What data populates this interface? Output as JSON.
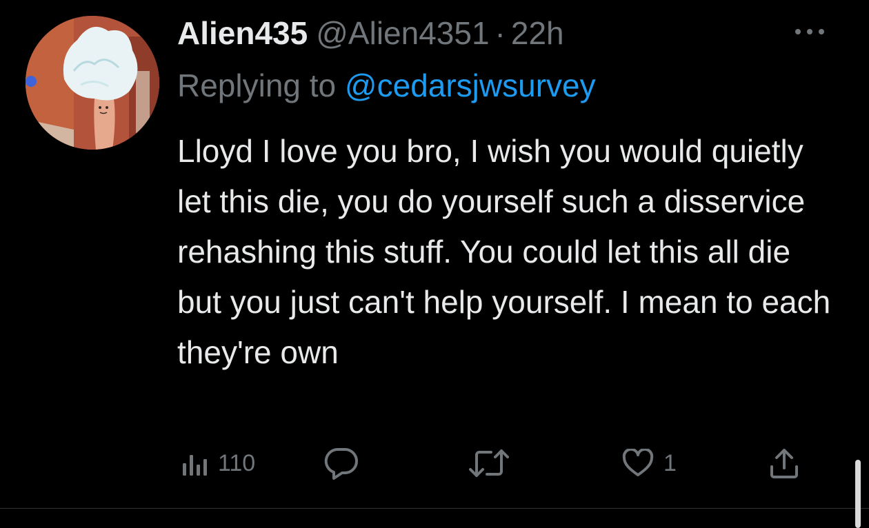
{
  "tweet": {
    "display_name": "Alien435",
    "handle": "@Alien4351",
    "separator": "·",
    "time": "22h",
    "replying_prefix": "Replying to",
    "replying_mention": "@cedarsjwsurvey",
    "text": "Lloyd I love you bro, I wish you would quietly let this die, you do yourself such a disservice rehashing this stuff. You could let this all die but you just can't help yourself. I mean to each they're own"
  },
  "actions": {
    "views": {
      "icon": "analytics-icon",
      "count": "110"
    },
    "reply": {
      "icon": "reply-bubble-icon"
    },
    "retweet": {
      "icon": "retweet-icon"
    },
    "like": {
      "icon": "heart-icon",
      "count": "1"
    },
    "share": {
      "icon": "share-icon"
    }
  },
  "colors": {
    "background": "#000000",
    "text_primary": "#e7e9ea",
    "text_secondary": "#71767b",
    "accent": "#1d9bf0",
    "divider": "#2f3336"
  }
}
